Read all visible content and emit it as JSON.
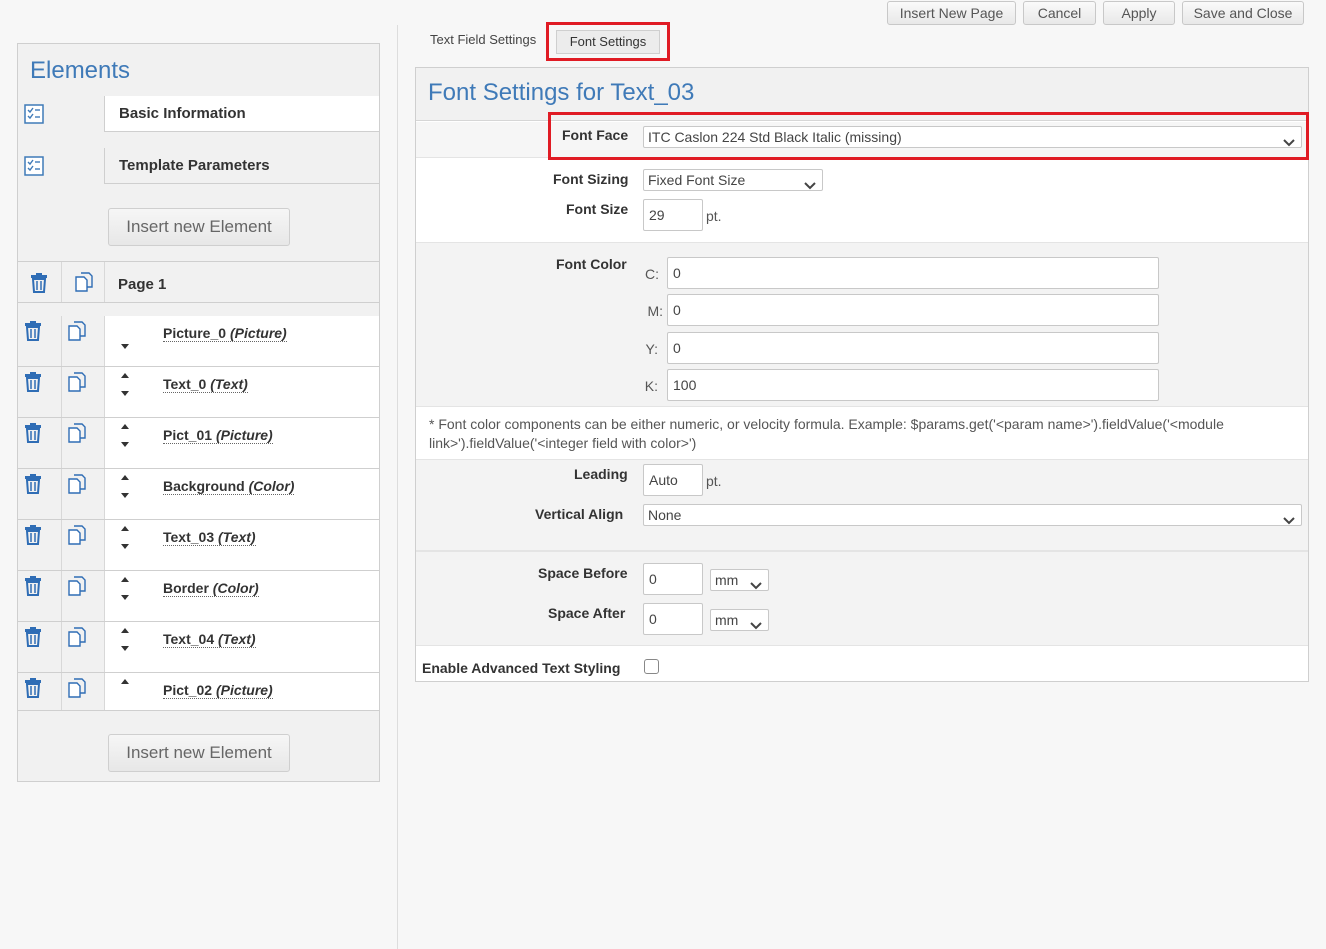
{
  "toolbar": {
    "insert_new_page": "Insert New Page",
    "cancel": "Cancel",
    "apply": "Apply",
    "save_and_close": "Save and Close"
  },
  "tabs": {
    "text_field_settings": "Text Field Settings",
    "font_settings": "Font Settings"
  },
  "left_panel": {
    "title": "Elements",
    "sections": [
      {
        "label": "Basic Information",
        "icon": "checklist-icon"
      },
      {
        "label": "Template Parameters",
        "icon": "checklist-icon"
      }
    ],
    "insert_button": "Insert new Element",
    "page_label": "Page 1",
    "elements": [
      {
        "name": "Picture_0",
        "type": "(Picture)"
      },
      {
        "name": "Text_0",
        "type": "(Text)"
      },
      {
        "name": "Pict_01",
        "type": "(Picture)"
      },
      {
        "name": "Background",
        "type": "(Color)"
      },
      {
        "name": "Text_03",
        "type": "(Text)"
      },
      {
        "name": "Border",
        "type": "(Color)"
      },
      {
        "name": "Text_04",
        "type": "(Text)"
      },
      {
        "name": "Pict_02",
        "type": "(Picture)"
      }
    ],
    "insert_button_bottom": "Insert new Element"
  },
  "settings": {
    "title": "Font Settings for Text_03",
    "font_face": {
      "label": "Font Face",
      "value": "ITC Caslon 224 Std Black Italic (missing)"
    },
    "font_sizing": {
      "label": "Font Sizing",
      "value": "Fixed Font Size"
    },
    "font_size": {
      "label": "Font Size",
      "value": "29",
      "unit": "pt."
    },
    "font_color": {
      "label": "Font Color",
      "c_label": "C:",
      "c": "0",
      "m_label": "M:",
      "m": "0",
      "y_label": "Y:",
      "y": "0",
      "k_label": "K:",
      "k": "100"
    },
    "note": "* Font color components can be either numeric, or velocity formula. Example: $params.get('<param name>').fieldValue('<module link>').fieldValue('<integer field with color>')",
    "leading": {
      "label": "Leading",
      "value": "Auto",
      "unit": "pt."
    },
    "vertical_align": {
      "label": "Vertical Align",
      "value": "None"
    },
    "space_before": {
      "label": "Space Before",
      "value": "0",
      "unit": "mm"
    },
    "space_after": {
      "label": "Space After",
      "value": "0",
      "unit": "mm"
    },
    "advanced_styling": {
      "label": "Enable Advanced Text Styling",
      "checked": false
    }
  },
  "colors": {
    "accent": "#3f7ab8",
    "highlight": "#e01b24"
  }
}
